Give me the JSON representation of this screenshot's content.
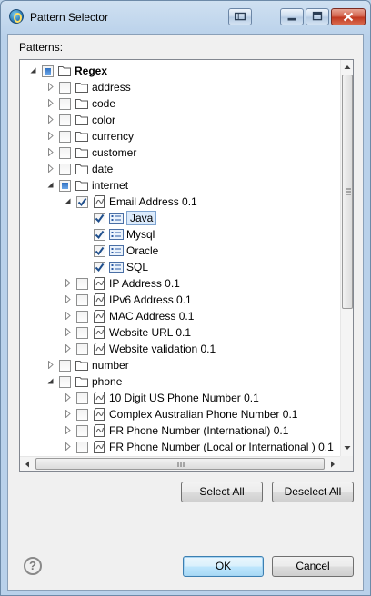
{
  "window": {
    "title": "Pattern Selector"
  },
  "labels": {
    "patterns": "Patterns:"
  },
  "tree": [
    {
      "label": "Regex",
      "depth": 0,
      "exp": "open",
      "cb": "partial",
      "icon": "folder",
      "bold": true
    },
    {
      "label": "address",
      "depth": 1,
      "exp": "closed",
      "cb": "off",
      "icon": "folder"
    },
    {
      "label": "code",
      "depth": 1,
      "exp": "closed",
      "cb": "off",
      "icon": "folder"
    },
    {
      "label": "color",
      "depth": 1,
      "exp": "closed",
      "cb": "off",
      "icon": "folder"
    },
    {
      "label": "currency",
      "depth": 1,
      "exp": "closed",
      "cb": "off",
      "icon": "folder"
    },
    {
      "label": "customer",
      "depth": 1,
      "exp": "closed",
      "cb": "off",
      "icon": "folder"
    },
    {
      "label": "date",
      "depth": 1,
      "exp": "closed",
      "cb": "off",
      "icon": "folder"
    },
    {
      "label": "internet",
      "depth": 1,
      "exp": "open",
      "cb": "partial",
      "icon": "folder"
    },
    {
      "label": "Email Address 0.1",
      "depth": 2,
      "exp": "open",
      "cb": "on",
      "icon": "pattern"
    },
    {
      "label": "Java",
      "depth": 3,
      "exp": "none",
      "cb": "on",
      "icon": "language",
      "selected": true
    },
    {
      "label": "Mysql",
      "depth": 3,
      "exp": "none",
      "cb": "on",
      "icon": "language"
    },
    {
      "label": "Oracle",
      "depth": 3,
      "exp": "none",
      "cb": "on",
      "icon": "language"
    },
    {
      "label": "SQL",
      "depth": 3,
      "exp": "none",
      "cb": "on",
      "icon": "language"
    },
    {
      "label": "IP Address 0.1",
      "depth": 2,
      "exp": "closed",
      "cb": "off",
      "icon": "pattern"
    },
    {
      "label": "IPv6 Address 0.1",
      "depth": 2,
      "exp": "closed",
      "cb": "off",
      "icon": "pattern"
    },
    {
      "label": "MAC Address 0.1",
      "depth": 2,
      "exp": "closed",
      "cb": "off",
      "icon": "pattern"
    },
    {
      "label": "Website URL 0.1",
      "depth": 2,
      "exp": "closed",
      "cb": "off",
      "icon": "pattern"
    },
    {
      "label": "Website validation 0.1",
      "depth": 2,
      "exp": "closed",
      "cb": "off",
      "icon": "pattern"
    },
    {
      "label": "number",
      "depth": 1,
      "exp": "closed",
      "cb": "off",
      "icon": "folder"
    },
    {
      "label": "phone",
      "depth": 1,
      "exp": "open",
      "cb": "off",
      "icon": "folder"
    },
    {
      "label": "10 Digit US Phone Number 0.1",
      "depth": 2,
      "exp": "closed",
      "cb": "off",
      "icon": "pattern"
    },
    {
      "label": "Complex Australian Phone Number 0.1",
      "depth": 2,
      "exp": "closed",
      "cb": "off",
      "icon": "pattern"
    },
    {
      "label": "FR Phone Number (International) 0.1",
      "depth": 2,
      "exp": "closed",
      "cb": "off",
      "icon": "pattern"
    },
    {
      "label": "FR Phone Number (Local or International ) 0.1",
      "depth": 2,
      "exp": "closed",
      "cb": "off",
      "icon": "pattern"
    }
  ],
  "buttons": {
    "select_all": "Select All",
    "deselect_all": "Deselect All",
    "ok": "OK",
    "cancel": "Cancel",
    "help": "?"
  }
}
